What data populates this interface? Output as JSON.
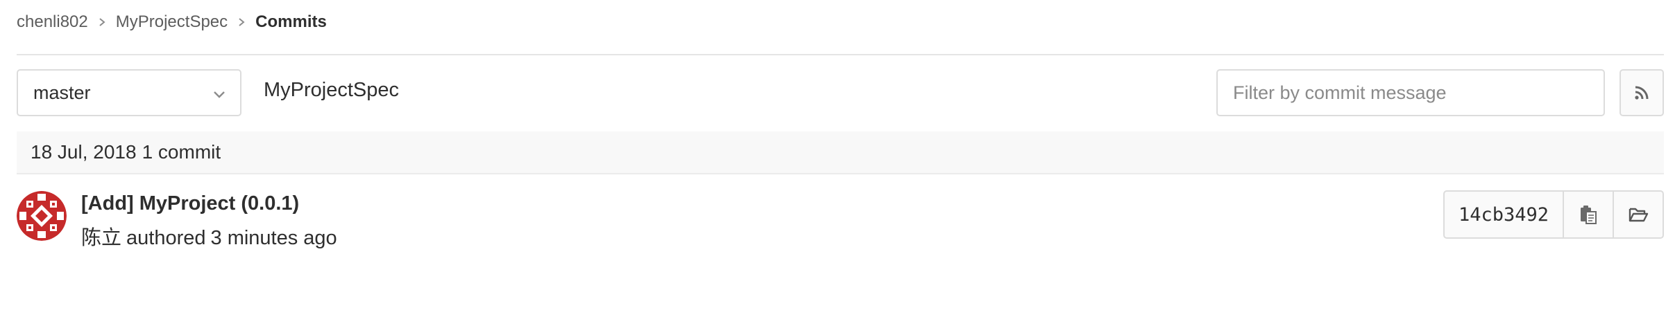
{
  "breadcrumb": {
    "items": [
      {
        "label": "chenli802"
      },
      {
        "label": "MyProjectSpec"
      },
      {
        "label": "Commits"
      }
    ]
  },
  "controls": {
    "branch_selected": "master",
    "project_name": "MyProjectSpec",
    "filter_placeholder": "Filter by commit message",
    "rss_icon": "rss-icon"
  },
  "commit_day": {
    "date": "18 Jul, 2018",
    "count_label": "1 commit"
  },
  "commits": [
    {
      "title": "[Add] MyProject (0.0.1)",
      "author": "陈立",
      "action": "authored",
      "time_ago": "3 minutes ago",
      "sha": "14cb3492",
      "copy_icon": "clipboard-icon",
      "browse_icon": "folder-open-icon"
    }
  ],
  "colors": {
    "avatar_red": "#c62a2a",
    "border": "#dcdcdc",
    "header_bg": "#f8f8f8"
  }
}
